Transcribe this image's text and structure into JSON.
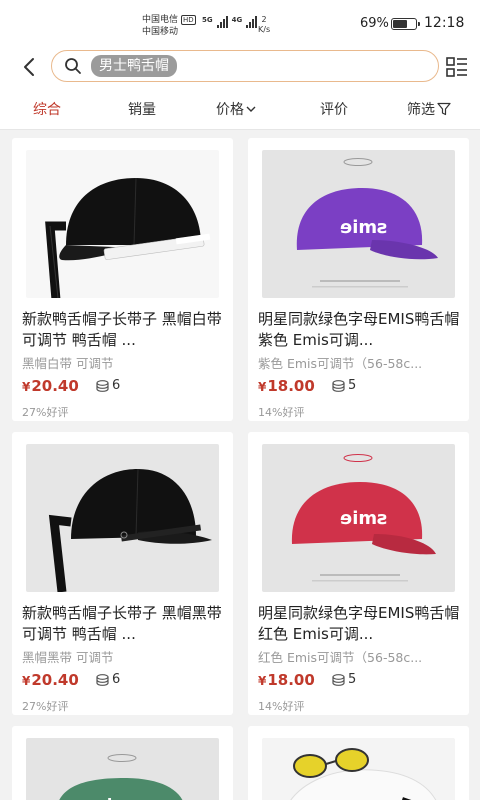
{
  "status_bar": {
    "carrier1": "中国电信",
    "carrier1_badge": "HD",
    "carrier2": "中国移动",
    "network1": "5G",
    "network2": "4G",
    "speed_value": "2",
    "speed_unit": "K/s",
    "battery_percent": "69%",
    "battery_level": 0.69,
    "time": "12:18"
  },
  "search": {
    "back_icon": "chevron-left-icon",
    "search_icon": "search-icon",
    "query_chip": "男士鸭舌帽",
    "layout_toggle_icon": "grid-list-toggle-icon"
  },
  "tabs": [
    {
      "label": "综合",
      "active": true
    },
    {
      "label": "销量",
      "active": false
    },
    {
      "label": "价格",
      "active": false,
      "icon": "chevron-down-icon"
    },
    {
      "label": "评价",
      "active": false
    },
    {
      "label": "筛选",
      "active": false,
      "icon": "filter-icon"
    }
  ],
  "products": [
    {
      "title": "新款鸭舌帽子长带子 黑帽白带 可调节 鸭舌帽 ...",
      "spec": "黑帽白带 可调节",
      "currency": "¥",
      "price": "20.40",
      "sales": "6",
      "rating": "27%好评",
      "image": "black-cap-white-strap",
      "cap_color": "#111111"
    },
    {
      "title": "明星同款绿色字母EMIS鸭舌帽 紫色 Emis可调...",
      "spec": "紫色 Emis可调节（56-58c...",
      "currency": "¥",
      "price": "18.00",
      "sales": "5",
      "rating": "14%好评",
      "image": "purple-emis-cap",
      "cap_color": "#7b3fc4"
    },
    {
      "title": "新款鸭舌帽子长带子 黑帽黑带 可调节 鸭舌帽 ...",
      "spec": "黑帽黑带 可调节",
      "currency": "¥",
      "price": "20.40",
      "sales": "6",
      "rating": "27%好评",
      "image": "black-cap-black-strap",
      "cap_color": "#111111"
    },
    {
      "title": "明星同款绿色字母EMIS鸭舌帽 红色 Emis可调...",
      "spec": "红色 Emis可调节（56-58c...",
      "currency": "¥",
      "price": "18.00",
      "sales": "5",
      "rating": "14%好评",
      "image": "red-emis-cap",
      "cap_color": "#d0324a"
    }
  ],
  "colors": {
    "accent": "#c0392b",
    "search_border": "#e9b98d",
    "chip_bg": "#9b9b9b"
  }
}
